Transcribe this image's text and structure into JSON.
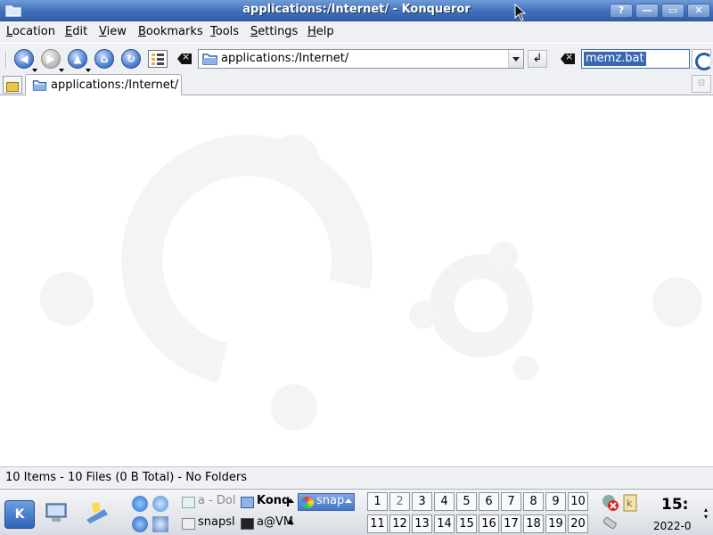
{
  "window": {
    "title": "applications:/Internet/ - Konqueror",
    "buttons": {
      "help": "?",
      "minimize": "—",
      "maximize": "▭",
      "close": "✕"
    }
  },
  "menu": [
    "Location",
    "Edit",
    "View",
    "Bookmarks",
    "Tools",
    "Settings",
    "Help"
  ],
  "toolbar": {
    "location": "applications:/Internet/",
    "go_label": "↲",
    "search_value": "memz.bat"
  },
  "tabs": [
    {
      "label": "applications:/Internet/"
    }
  ],
  "status": "10 Items - 10 Files (0 B Total) - No Folders",
  "taskbar": {
    "tasks": [
      {
        "label": "a - Dol",
        "active": false,
        "dim": true
      },
      {
        "label": "Konq",
        "active": false,
        "bold": true
      },
      {
        "label": "snap",
        "active": true
      },
      {
        "label": "snapsl",
        "active": false
      },
      {
        "label": "a@VM",
        "active": false
      }
    ],
    "desktops": [
      "1",
      "2",
      "3",
      "4",
      "5",
      "6",
      "7",
      "8",
      "9",
      "10",
      "11",
      "12",
      "13",
      "14",
      "15",
      "16",
      "17",
      "18",
      "19",
      "20"
    ],
    "current_desktop": "2",
    "clock": "15:",
    "date": "2022-0"
  },
  "colors": {
    "accent": "#3f70bd",
    "selection": "#3a67b2"
  }
}
